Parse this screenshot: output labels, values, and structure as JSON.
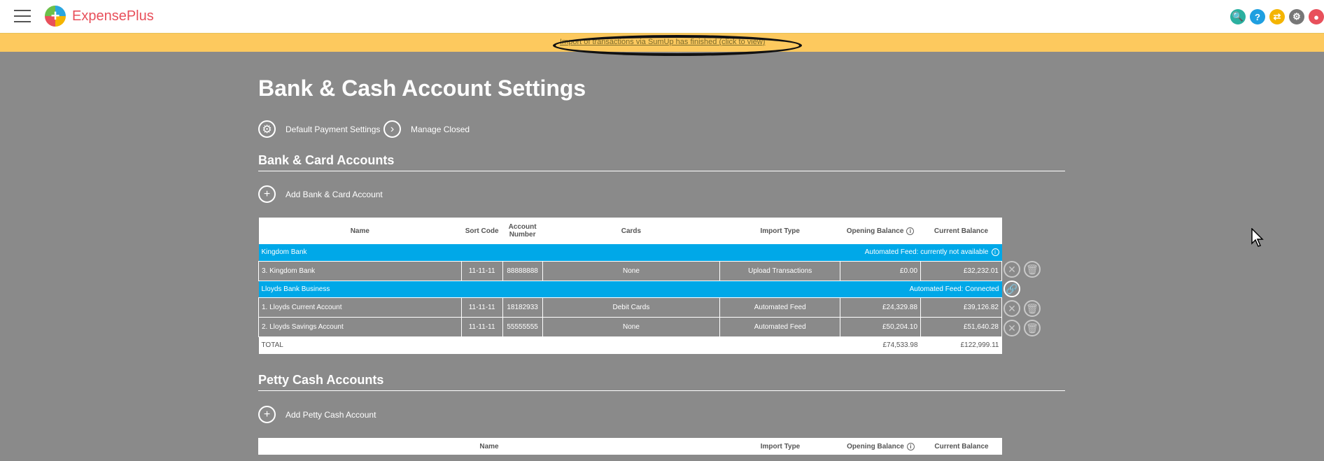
{
  "app": {
    "name": "ExpensePlus",
    "name_expense": "Expense",
    "name_plus": "Plus"
  },
  "topbar": {
    "icons": [
      {
        "name": "search-icon",
        "glyph": "🔍",
        "color": "#2bb0a0"
      },
      {
        "name": "help-icon",
        "glyph": "?",
        "color": "#1f9fe0"
      },
      {
        "name": "sync-icon",
        "glyph": "⇄",
        "color": "#f4b400"
      },
      {
        "name": "gear-icon",
        "glyph": "⚙",
        "color": "#777777"
      },
      {
        "name": "user-icon",
        "glyph": "●",
        "color": "#e8505b"
      }
    ]
  },
  "banner": {
    "text": "Import of transactions via SumUp has finished (click to view)"
  },
  "page": {
    "title": "Bank & Cash Account Settings"
  },
  "actions": {
    "default_payment": "Default Payment Settings",
    "manage_closed": "Manage Closed"
  },
  "bank_section": {
    "title": "Bank & Card Accounts",
    "add_label": "Add Bank & Card Account",
    "headers": {
      "name": "Name",
      "sort_code": "Sort Code",
      "account_number": "Account Number",
      "cards": "Cards",
      "import_type": "Import Type",
      "opening_balance": "Opening Balance",
      "current_balance": "Current Balance"
    },
    "groups": [
      {
        "bank": "Kingdom Bank",
        "feed_status": "Automated Feed: currently not available",
        "rows": [
          {
            "name": "3. Kingdom Bank",
            "sort_code": "11-11-11",
            "account_number": "88888888",
            "cards": "None",
            "import_type": "Upload Transactions",
            "opening_balance": "£0.00",
            "current_balance": "£32,232.01"
          }
        ]
      },
      {
        "bank": "Lloyds Bank Business",
        "feed_status": "Automated Feed: Connected",
        "rows": [
          {
            "name": "1. Lloyds Current Account",
            "sort_code": "11-11-11",
            "account_number": "18182933",
            "cards": "Debit Cards",
            "import_type": "Automated Feed",
            "opening_balance": "£24,329.88",
            "current_balance": "£39,126.82"
          },
          {
            "name": "2. Lloyds Savings Account",
            "sort_code": "11-11-11",
            "account_number": "55555555",
            "cards": "None",
            "import_type": "Automated Feed",
            "opening_balance": "£50,204.10",
            "current_balance": "£51,640.28"
          }
        ]
      }
    ],
    "total": {
      "label": "TOTAL",
      "opening_balance": "£74,533.98",
      "current_balance": "£122,999.11"
    }
  },
  "petty_section": {
    "title": "Petty Cash Accounts",
    "add_label": "Add Petty Cash Account",
    "headers": {
      "name": "Name",
      "import_type": "Import Type",
      "opening_balance": "Opening Balance",
      "current_balance": "Current Balance"
    }
  }
}
